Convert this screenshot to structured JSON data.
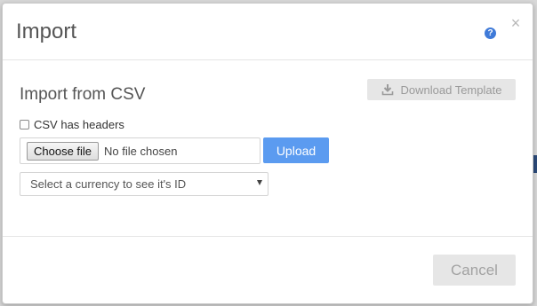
{
  "dialog": {
    "title": "Import",
    "help_icon": "question-circle-icon",
    "close_glyph": "×"
  },
  "body": {
    "section_title": "Import from CSV",
    "download_template_label": "Download Template",
    "download_icon": "download-icon",
    "csv_headers_label": "CSV has headers",
    "csv_headers_checked": false,
    "choose_file_label": "Choose file",
    "no_file_text": "No file chosen",
    "upload_label": "Upload",
    "currency_select_value": "Select a currency to see it's ID"
  },
  "footer": {
    "cancel_label": "Cancel"
  },
  "colors": {
    "primary_button": "#5b9bf0",
    "help_icon": "#3f7ad8",
    "disabled_button_bg": "#e6e6e6",
    "disabled_button_text": "#9a9a9a",
    "title_text": "#555555"
  }
}
